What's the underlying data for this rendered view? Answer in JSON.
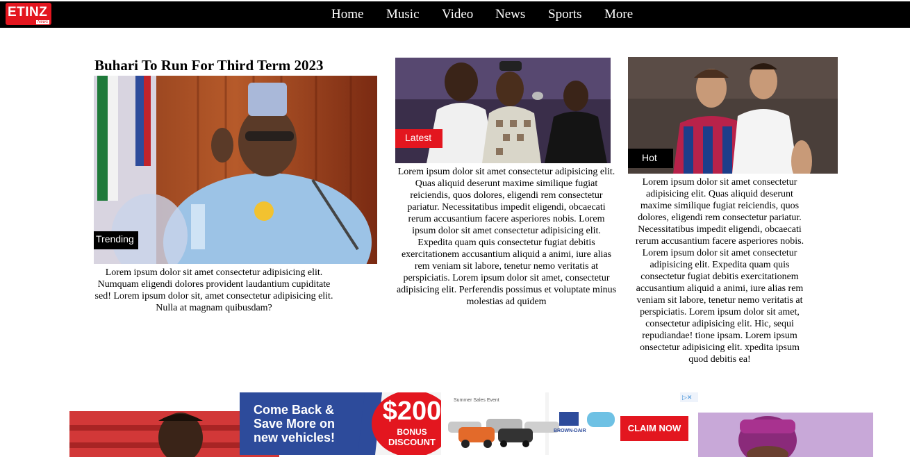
{
  "site": {
    "logo_text": "ETINZ",
    "logo_sub": "News",
    "nav": [
      "Home",
      "Music",
      "Video",
      "News",
      "Sports",
      "More"
    ]
  },
  "articles": [
    {
      "title": "Buhari To Run For Third Term 2023",
      "tag": "Trending",
      "text": "Lorem ipsum dolor sit amet consectetur adipisicing elit. Numquam eligendi dolores provident laudantium cupiditate sed! Lorem ipsum dolor sit, amet consectetur adipisicing elit. Nulla at magnam quibusdam?"
    },
    {
      "tag": "Latest",
      "text": "Lorem ipsum dolor sit amet consectetur adipisicing elit. Quas aliquid deserunt maxime similique fugiat reiciendis, quos dolores, eligendi rem consectetur pariatur. Necessitatibus impedit eligendi, obcaecati rerum accusantium facere asperiores nobis. Lorem ipsum dolor sit amet consectetur adipisicing elit. Expedita quam quis consectetur fugiat debitis exercitationem accusantium aliquid a animi, iure alias rem veniam sit labore, tenetur nemo veritatis at perspiciatis. Lorem ipsum dolor sit amet, consectetur adipisicing elit. Perferendis possimus et voluptate minus molestias ad quidem"
    },
    {
      "tag": "Hot",
      "text": "Lorem ipsum dolor sit amet consectetur adipisicing elit. Quas aliquid deserunt maxime similique fugiat reiciendis, quos dolores, eligendi rem consectetur pariatur. Necessitatibus impedit eligendi, obcaecati rerum accusantium facere asperiores nobis. Lorem ipsum dolor sit amet consectetur adipisicing elit. Expedita quam quis consectetur fugiat debitis exercitationem accusantium aliquid a animi, iure alias rem veniam sit labore, tenetur nemo veritatis at perspiciatis. Lorem ipsum dolor sit amet, consectetur adipisicing elit. Hic, sequi repudiandae! tione ipsam. Lorem ipsum onsectetur adipisicing elit. xpedita ipsum quod debitis ea!"
    }
  ],
  "ad": {
    "headline": "Come Back & Save More on new vehicles!",
    "amount": "$200",
    "bonus": "BONUS",
    "discount": "DISCOUNT",
    "cta": "CLAIM NOW",
    "brand": "BROWN-DAIR",
    "event_label": "Summer Sales Event"
  }
}
